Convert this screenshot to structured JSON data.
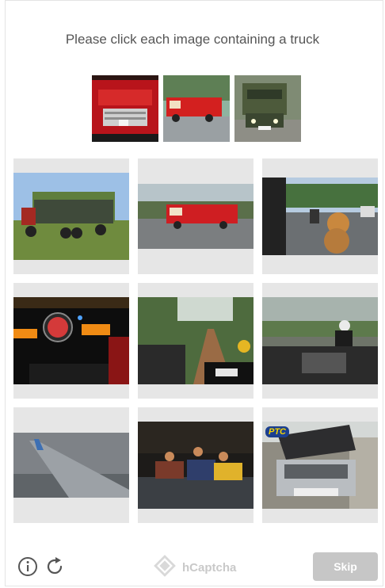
{
  "prompt": "Please click each image containing a truck",
  "footer": {
    "brand": "hCaptcha",
    "skip_label": "Skip"
  },
  "grid_label_overlays": {
    "bus_sign": "PTC"
  },
  "colors": {
    "skip_bg": "#c6c6c6",
    "tile_bg": "#e6e6e6",
    "brand": "#c9c9c9"
  },
  "icons": [
    "info-icon",
    "refresh-icon",
    "hcaptcha-logo-icon"
  ]
}
